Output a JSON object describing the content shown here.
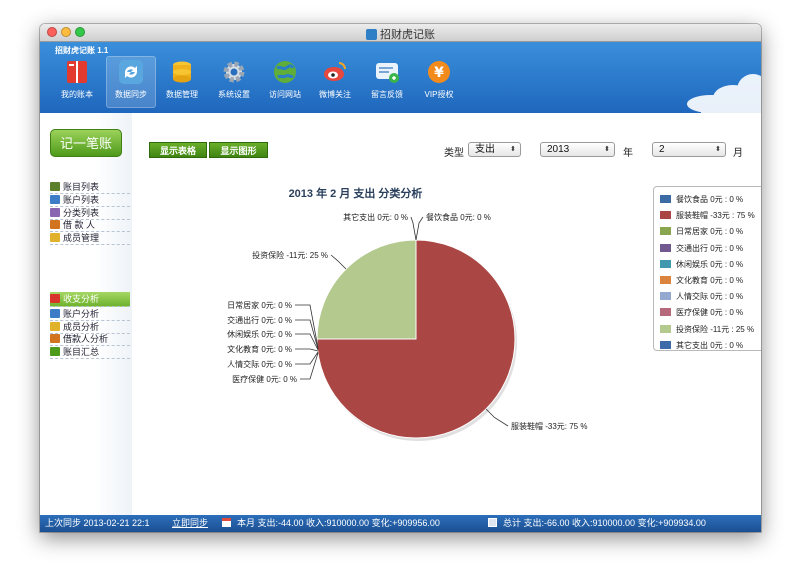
{
  "window": {
    "title": "招财虎记账",
    "version": "招财虎记账 1.1"
  },
  "toolbar": {
    "items": [
      {
        "label": "我的账本",
        "icon": "ledger-book-icon"
      },
      {
        "label": "数据同步",
        "icon": "sync-icon",
        "active": true
      },
      {
        "label": "数据管理",
        "icon": "database-icon"
      },
      {
        "label": "系统设置",
        "icon": "gear-icon"
      },
      {
        "label": "访问网站",
        "icon": "globe-icon"
      },
      {
        "label": "微博关注",
        "icon": "weibo-icon"
      },
      {
        "label": "留言反馈",
        "icon": "feedback-icon"
      },
      {
        "label": "VIP授权",
        "icon": "yen-icon"
      }
    ]
  },
  "sidebar": {
    "record_button": "记一笔账",
    "group1": [
      {
        "label": "账目列表",
        "icon": "list-icon"
      },
      {
        "label": "账户列表",
        "icon": "account-icon"
      },
      {
        "label": "分类列表",
        "icon": "category-icon"
      },
      {
        "label": "借 款 人",
        "icon": "borrower-icon"
      },
      {
        "label": "成员管理",
        "icon": "member-icon"
      }
    ],
    "group2": [
      {
        "label": "收支分析",
        "icon": "pie-icon",
        "selected": true
      },
      {
        "label": "账户分析",
        "icon": "account-icon"
      },
      {
        "label": "成员分析",
        "icon": "member-icon"
      },
      {
        "label": "借款人分析",
        "icon": "borrower-icon"
      },
      {
        "label": "账目汇总",
        "icon": "summary-icon"
      }
    ]
  },
  "filters": {
    "show_table": "显示表格",
    "show_chart": "显示图形",
    "type_label": "类型",
    "type_value": "支出",
    "year_value": "2013",
    "year_label": "年",
    "month_value": "2",
    "month_label": "月"
  },
  "chart_data": {
    "type": "pie",
    "title": "2013 年 2 月 支出 分类分析",
    "slices": [
      {
        "name": "餐饮食品",
        "value": 0,
        "label": "餐饮食品 0元: 0 %",
        "legend": "餐饮食品 0元 : 0 %",
        "color": "#3b6ba5"
      },
      {
        "name": "服装鞋帽",
        "value": -33,
        "percent": 75,
        "label": "服装鞋帽 -33元: 75 %",
        "legend": "服装鞋帽 -33元 : 75 %",
        "color": "#aa4643"
      },
      {
        "name": "日常居家",
        "value": 0,
        "label": "日常居家 0元: 0 %",
        "legend": "日常居家 0元 : 0 %",
        "color": "#89a54e"
      },
      {
        "name": "交通出行",
        "value": 0,
        "label": "交通出行 0元: 0 %",
        "legend": "交通出行 0元 : 0 %",
        "color": "#71588f"
      },
      {
        "name": "休闲娱乐",
        "value": 0,
        "label": "休闲娱乐 0元: 0 %",
        "legend": "休闲娱乐 0元 : 0 %",
        "color": "#4198af"
      },
      {
        "name": "文化教育",
        "value": 0,
        "label": "文化教育 0元: 0 %",
        "legend": "文化教育 0元 : 0 %",
        "color": "#db843d"
      },
      {
        "name": "人情交际",
        "value": 0,
        "label": "人情交际 0元: 0 %",
        "legend": "人情交际 0元 : 0 %",
        "color": "#93a9cf"
      },
      {
        "name": "医疗保健",
        "value": 0,
        "label": "医疗保健 0元: 0 %",
        "legend": "医疗保健 0元 : 0 %",
        "color": "#b5697a"
      },
      {
        "name": "投资保险",
        "value": -11,
        "percent": 25,
        "label": "投资保险 -11元: 25 %",
        "legend": "投资保险 -11元 : 25 %",
        "color": "#b3c98e"
      },
      {
        "name": "其它支出",
        "value": 0,
        "label": "其它支出 0元: 0 %",
        "legend": "其它支出 0元 : 0 %",
        "color": "#3d6aa8"
      }
    ],
    "legend_position": "right"
  },
  "status": {
    "last_sync": "上次同步 2013-02-21 22:1",
    "sync_now": "立即同步",
    "month_summary": "本月  支出:-44.00 收入:910000.00 变化:+909956.00",
    "total_summary": "总计  支出:-66.00 收入:910000.00 变化:+909934.00"
  }
}
